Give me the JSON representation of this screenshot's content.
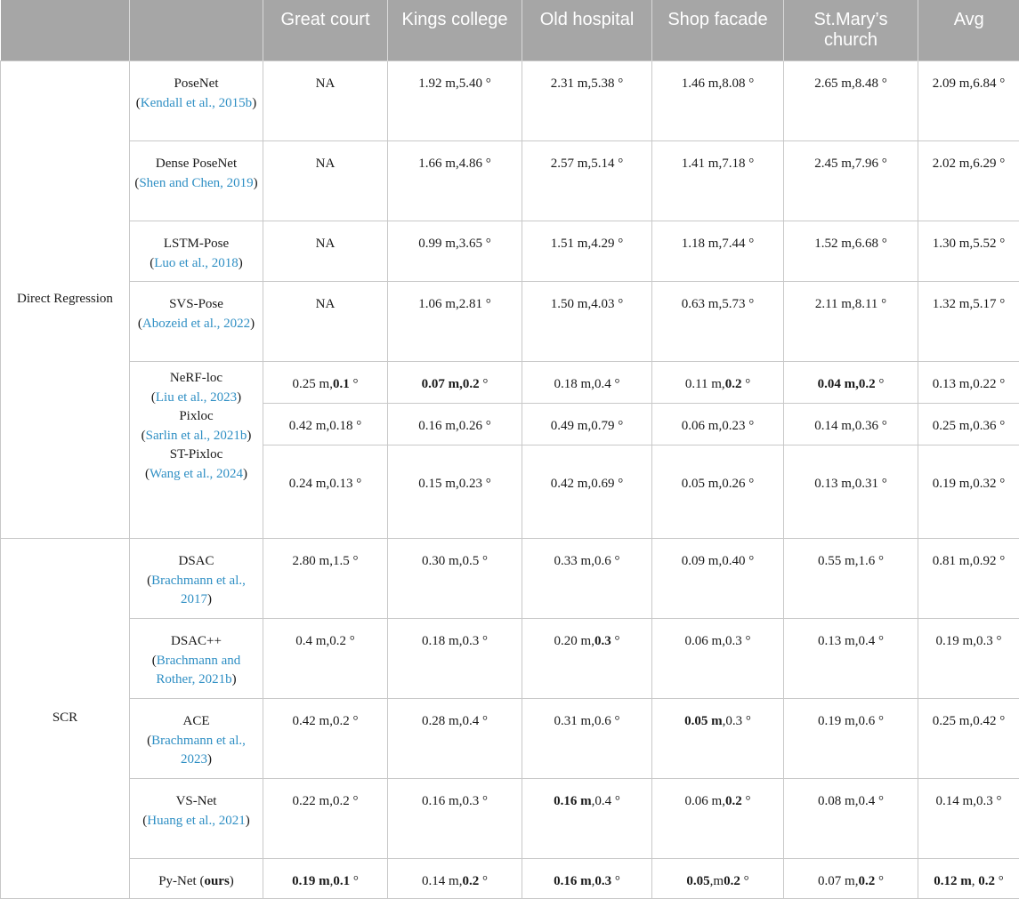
{
  "header": {
    "group": "",
    "method": "",
    "great_court": "Great court",
    "kings_college": "Kings college",
    "old_hospital": "Old hospital",
    "shop_facade": "Shop facade",
    "st_marys_church": "St.Mary’s church",
    "avg": "Avg"
  },
  "groups": {
    "direct": "Direct Regression",
    "scr": "SCR"
  },
  "rows": [
    {
      "name": "PoseNet",
      "open": "(",
      "cite": "Kendall et al., 2015b",
      "close": ")",
      "gc": "NA",
      "kc": "1.92 m,5.40 °",
      "oh": "2.31 m,5.38 °",
      "sf": "1.46 m,8.08 °",
      "sm": "2.65 m,8.48 °",
      "avg": "2.09 m,6.84 °"
    },
    {
      "name": "Dense PoseNet",
      "open": "(",
      "cite": "Shen and Chen, 2019",
      "close": ")",
      "gc": "NA",
      "kc": "1.66 m,4.86 °",
      "oh": "2.57 m,5.14 °",
      "sf": "1.41 m,7.18 °",
      "sm": "2.45 m,7.96 °",
      "avg": "2.02 m,6.29 °"
    },
    {
      "name": "LSTM-Pose",
      "open": "(",
      "cite": "Luo et al., 2018",
      "close": ")",
      "gc": "NA",
      "kc": "0.99 m,3.65 °",
      "oh": "1.51 m,4.29 °",
      "sf": "1.18 m,7.44 °",
      "sm": "1.52 m,6.68 °",
      "avg": "1.30 m,5.52 °"
    },
    {
      "name": "SVS-Pose",
      "open": "(",
      "cite": "Abozeid et al., 2022",
      "close": ")",
      "gc": "NA",
      "kc": "1.06 m,2.81 °",
      "oh": "1.50 m,4.03 °",
      "sf": "0.63 m,5.73 °",
      "sm": "2.11 m,8.11 °",
      "avg": "1.32 m,5.17 °"
    },
    {
      "name": "NeRF-loc",
      "open": "(",
      "cite": "Liu et al., 2023",
      "close": ")",
      "gc_a": "0.25 m,",
      "gc_b": "0.1",
      "gc_c": " °",
      "kc_a": "0.07 m,0.2",
      "kc_b": " °",
      "oh": "0.18 m,0.4 °",
      "sf_a": "0.11 m,",
      "sf_b": "0.2",
      "sf_c": " °",
      "sm_a": "0.04 m,0.2",
      "sm_b": " °",
      "avg": "0.13 m,0.22 °"
    },
    {
      "name": "Pixloc",
      "open": "(",
      "cite": "Sarlin et al., 2021b",
      "close": ")",
      "gc": "0.42 m,0.18 °",
      "kc": "0.16 m,0.26 °",
      "oh": "0.49 m,0.79 °",
      "sf": "0.06 m,0.23 °",
      "sm": "0.14 m,0.36 °",
      "avg": "0.25 m,0.36 °"
    },
    {
      "name": "ST-Pixloc",
      "open": "(",
      "cite": "Wang et al., 2024",
      "close": ")",
      "gc": "0.24 m,0.13 °",
      "kc": "0.15 m,0.23 °",
      "oh": "0.42 m,0.69 °",
      "sf": "0.05 m,0.26 °",
      "sm": "0.13 m,0.31 °",
      "avg": "0.19 m,0.32 °"
    },
    {
      "name": "DSAC",
      "open": "(",
      "cite": "Brachmann et al., 2017",
      "close": ")",
      "gc": "2.80 m,1.5 °",
      "kc": "0.30 m,0.5 °",
      "oh": "0.33 m,0.6 °",
      "sf": "0.09 m,0.40 °",
      "sm": "0.55 m,1.6 °",
      "avg": "0.81 m,0.92 °"
    },
    {
      "name": "DSAC++",
      "open": "(",
      "cite": "Brachmann and Rother, 2021b",
      "close": ")",
      "gc": "0.4 m,0.2 °",
      "kc": "0.18 m,0.3 °",
      "oh_a": "0.20 m,",
      "oh_b": "0.3",
      "oh_c": " °",
      "sf": "0.06 m,0.3 °",
      "sm": "0.13 m,0.4 °",
      "avg": "0.19 m,0.3 °"
    },
    {
      "name": "ACE",
      "open": "(",
      "cite": "Brachmann et al., 2023",
      "close": ")",
      "gc": "0.42 m,0.2 °",
      "kc": "0.28 m,0.4 °",
      "oh": "0.31 m,0.6 °",
      "sf_a": "0.05 m",
      "sf_b": ",0.3 °",
      "sm": "0.19 m,0.6 °",
      "avg": "0.25 m,0.42 °"
    },
    {
      "name": "VS-Net",
      "open": "(",
      "cite": "Huang et al., 2021",
      "close": ")",
      "gc": "0.22 m,0.2 °",
      "kc": "0.16 m,0.3 °",
      "oh_a": "0.16 m",
      "oh_b": ",0.4 °",
      "sf_a": "0.06 m,",
      "sf_b": "0.2",
      "sf_c": " °",
      "sm": "0.08 m,0.4 °",
      "avg": "0.14 m,0.3 °"
    },
    {
      "name_a": "Py-Net (",
      "name_b": "ours",
      "name_c": ")",
      "gc_a": "0.19 m",
      "gc_b": ",",
      "gc_c": "0.1",
      "gc_d": " °",
      "kc_a": "0.14 m,",
      "kc_b": "0.2",
      "kc_c": " °",
      "oh_a": "0.16 m",
      "oh_b": ",",
      "oh_c": "0.3",
      "oh_d": " °",
      "sf_a": "0.05",
      "sf_b": ",m",
      "sf_c": "0.2",
      "sf_d": " °",
      "sm_a": "0.07 m,",
      "sm_b": "0.2",
      "sm_c": " °",
      "avg_a": "0.12 m",
      "avg_b": ", ",
      "avg_c": "0.2",
      "avg_d": " °"
    }
  ]
}
